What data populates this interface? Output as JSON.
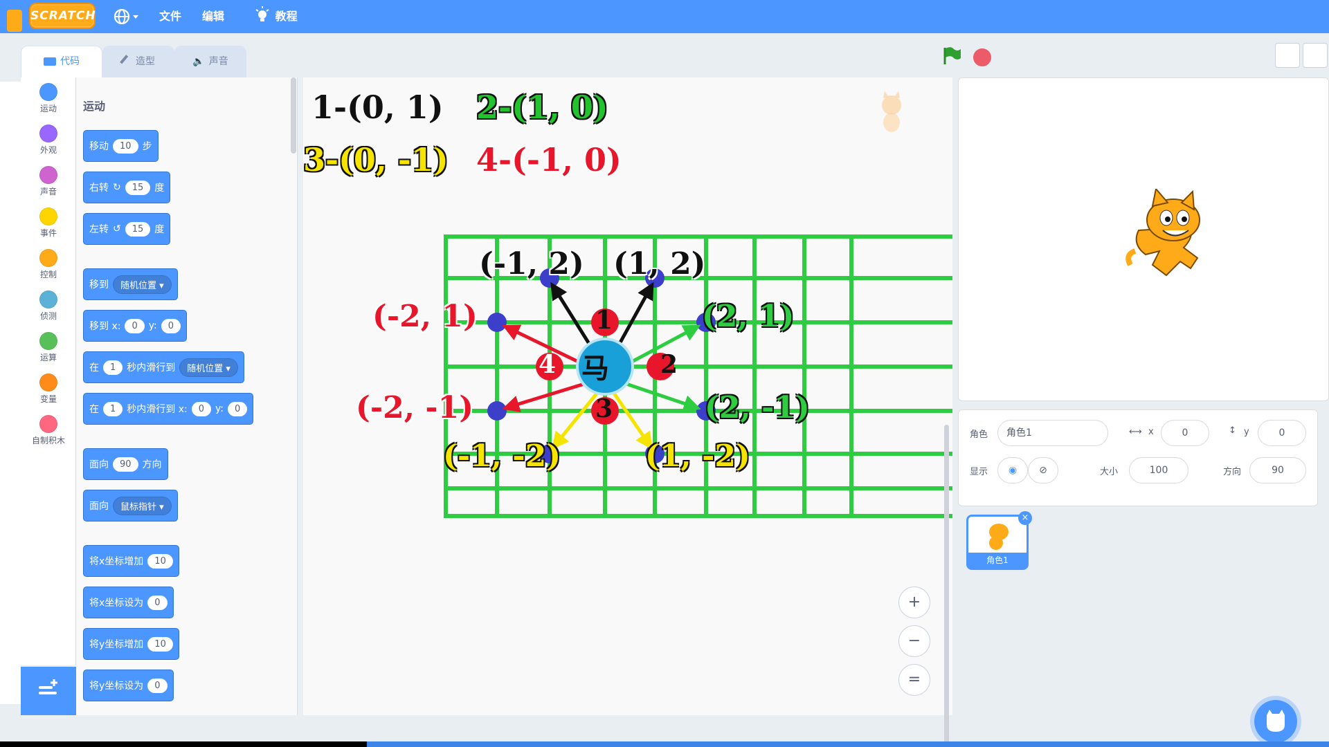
{
  "menu": {
    "logo": "SCRATCH",
    "file": "文件",
    "edit": "编辑",
    "tutorials": "教程"
  },
  "tabs": [
    {
      "label": "代码"
    },
    {
      "label": "造型"
    },
    {
      "label": "声音"
    }
  ],
  "categories": [
    {
      "label": "运动",
      "color": "#4c97ff"
    },
    {
      "label": "外观",
      "color": "#9966ff"
    },
    {
      "label": "声音",
      "color": "#cf63cf"
    },
    {
      "label": "事件",
      "color": "#ffd500"
    },
    {
      "label": "控制",
      "color": "#ffab19"
    },
    {
      "label": "侦测",
      "color": "#5cb1d6"
    },
    {
      "label": "运算",
      "color": "#59c059"
    },
    {
      "label": "变量",
      "color": "#ff8c1a"
    },
    {
      "label": "自制积木",
      "color": "#ff6680"
    }
  ],
  "palette": {
    "title": "运动",
    "move": {
      "label": "移动",
      "value": "10",
      "unit": "步"
    },
    "turn_right": {
      "label": "右转",
      "value": "15",
      "unit": "度"
    },
    "turn_left": {
      "label": "左转",
      "value": "15",
      "unit": "度"
    },
    "goto": {
      "label": "移到",
      "option": "随机位置"
    },
    "goto_xy": {
      "label": "移到 x:",
      "x": "0",
      "ylabel": "y:",
      "y": "0"
    },
    "glide_to": {
      "label": "在",
      "secs": "1",
      "mid": "秒内滑行到",
      "option": "随机位置"
    },
    "glide_xy": {
      "label": "在",
      "secs": "1",
      "mid": "秒内滑行到 x:",
      "x": "0",
      "ylabel": "y:",
      "y": "0"
    },
    "point_dir": {
      "label": "面向",
      "value": "90",
      "unit": "方向"
    },
    "point_towards": {
      "label": "面向",
      "option": "鼠标指针"
    },
    "change_x": {
      "label": "将x坐标增加",
      "value": "10"
    },
    "set_x": {
      "label": "将x坐标设为",
      "value": "0"
    },
    "change_y": {
      "label": "将y坐标增加",
      "value": "10"
    },
    "set_y": {
      "label": "将y坐标设为",
      "value": "0"
    }
  },
  "legend": {
    "l1": "1-(0, 1)",
    "l2": "2-(1, 0)",
    "l3": "3-(0, -1)",
    "l4": "4-(-1, 0)"
  },
  "diagram": {
    "center": "马",
    "n1": "1",
    "n2": "2",
    "n3": "3",
    "n4": "4",
    "m_neg1_2": "(-1, 2)",
    "m_1_2": "(1, 2)",
    "m_neg2_1": "(-2, 1)",
    "m_2_1": "(2, 1)",
    "m_neg2_neg1": "(-2, -1)",
    "m_2_neg1": "(2, -1)",
    "m_neg1_neg2": "(-1, -2)",
    "m_1_neg2": "(1, -2)"
  },
  "zoom": {
    "in": "+",
    "out": "−",
    "reset": "="
  },
  "sprite": {
    "name_label": "角色",
    "name": "角色1",
    "x_label": "x",
    "x": "0",
    "y_label": "y",
    "y": "0",
    "show_label": "显示",
    "size_label": "大小",
    "size": "100",
    "dir_label": "方向",
    "dir": "90",
    "thumb_label": "角色1"
  },
  "colors": {
    "scratch_blue": "#4c97ff",
    "grid_green": "#2ecc40",
    "red": "#e8162b",
    "black": "#111111",
    "yellow": "#f5e400",
    "green_label": "#22c32e"
  }
}
